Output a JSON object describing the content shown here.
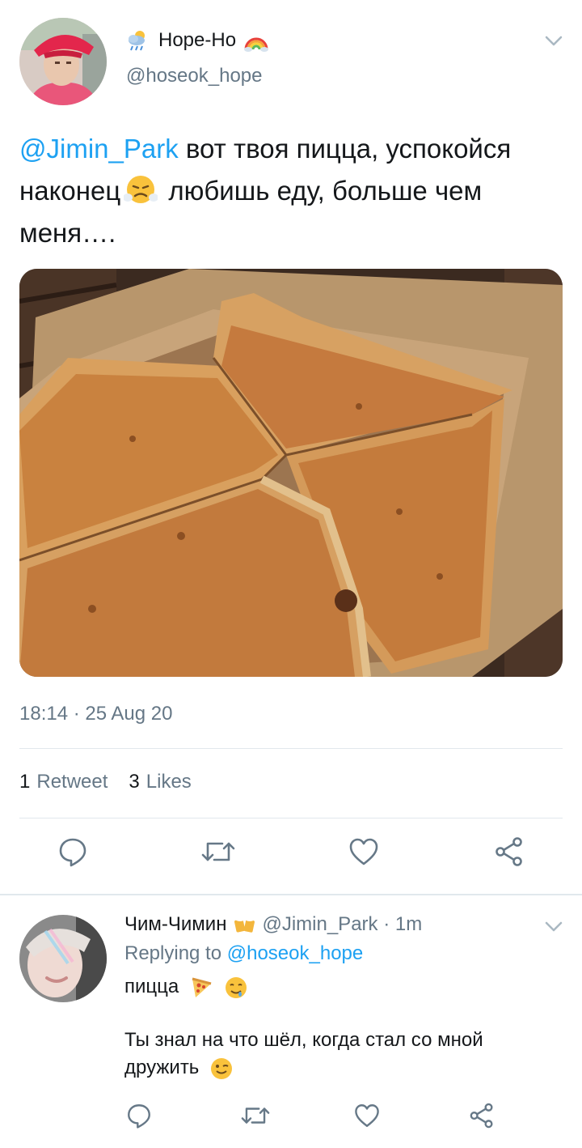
{
  "tweet": {
    "display_name": "Hope-Ho",
    "handle": "@hoseok_hope",
    "text": {
      "mention": "@Jimin_Park",
      "part1": " вот твоя пицца, успокойся наконец",
      "part2": " любишь еду, больше чем меня…."
    },
    "timestamp": "18:14 · 25 Aug 20",
    "stats": {
      "retweets_count": "1",
      "retweets_label": "Retweet",
      "likes_count": "3",
      "likes_label": "Likes"
    }
  },
  "reply": {
    "display_name": "Чим-Чимин",
    "meta": "@Jimin_Park · 1m",
    "replying_prefix": "Replying to ",
    "replying_to": "@hoseok_hope",
    "line1": "пицца",
    "line2": "Ты знал на что шёл, когда стал со мной дружить"
  },
  "colors": {
    "accent": "#1da1f2",
    "secondary_text": "#657786",
    "icon": "#667887",
    "divider": "#e1e8ed"
  },
  "icons": {
    "name_emoji_1": "sun-behind-rain-cloud",
    "name_emoji_2": "rainbow",
    "text_emoji": "face-with-steam-from-nose",
    "reply_name_emoji": "beer-mugs",
    "reply_emoji_1": "pizza",
    "reply_emoji_2": "drooling-face",
    "reply_emoji_3": "winking-face"
  }
}
